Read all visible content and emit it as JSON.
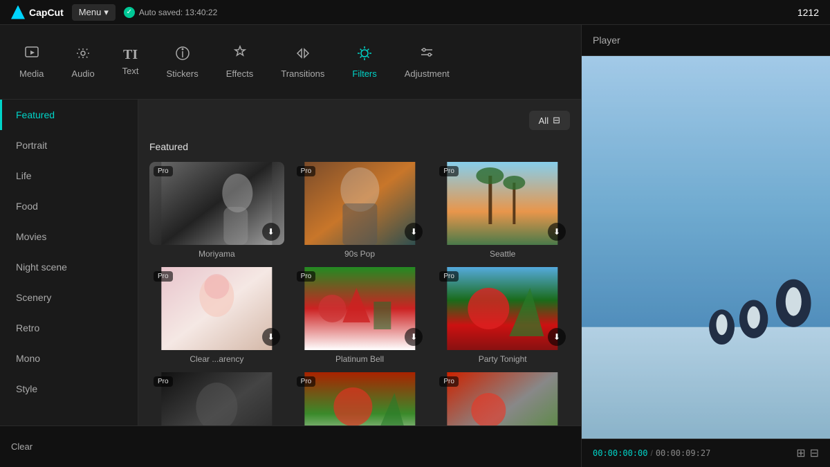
{
  "topbar": {
    "logo_text": "CapCut",
    "menu_label": "Menu",
    "autosaved_text": "Auto saved: 13:40:22",
    "project_number": "1212"
  },
  "nav": {
    "tabs": [
      {
        "id": "media",
        "label": "Media",
        "icon": "▶"
      },
      {
        "id": "audio",
        "label": "Audio",
        "icon": "♪"
      },
      {
        "id": "text",
        "label": "Text",
        "icon": "TI"
      },
      {
        "id": "stickers",
        "label": "Stickers",
        "icon": "⏱"
      },
      {
        "id": "effects",
        "label": "Effects",
        "icon": "✦"
      },
      {
        "id": "transitions",
        "label": "Transitions",
        "icon": "⋈"
      },
      {
        "id": "filters",
        "label": "Filters",
        "icon": "◎",
        "active": true
      },
      {
        "id": "adjustment",
        "label": "Adjustment",
        "icon": "⚙"
      }
    ]
  },
  "sidebar": {
    "items": [
      {
        "id": "featured",
        "label": "Featured",
        "active": true
      },
      {
        "id": "portrait",
        "label": "Portrait"
      },
      {
        "id": "life",
        "label": "Life"
      },
      {
        "id": "food",
        "label": "Food"
      },
      {
        "id": "movies",
        "label": "Movies"
      },
      {
        "id": "nightscene",
        "label": "Night scene"
      },
      {
        "id": "scenery",
        "label": "Scenery"
      },
      {
        "id": "retro",
        "label": "Retro"
      },
      {
        "id": "mono",
        "label": "Mono"
      },
      {
        "id": "style",
        "label": "Style"
      }
    ]
  },
  "filters": {
    "all_btn": "All",
    "section_title": "Featured",
    "items": [
      {
        "id": "moriyama",
        "name": "Moriyama",
        "badge": "Pro",
        "thumb_class": "thumb-moriyama"
      },
      {
        "id": "90spop",
        "name": "90s Pop",
        "badge": "Pro",
        "thumb_class": "thumb-90spop"
      },
      {
        "id": "seattle",
        "name": "Seattle",
        "badge": "Pro",
        "thumb_class": "thumb-seattle"
      },
      {
        "id": "clearancy",
        "name": "Clear ...arency",
        "badge": "Pro",
        "thumb_class": "thumb-clearancy"
      },
      {
        "id": "platinumbell",
        "name": "Platinum Bell",
        "badge": "Pro",
        "thumb_class": "thumb-platinum"
      },
      {
        "id": "partytonight",
        "name": "Party Tonight",
        "badge": "Pro",
        "thumb_class": "thumb-party"
      },
      {
        "id": "extra1",
        "name": "",
        "badge": "Pro",
        "thumb_class": "thumb-extra1"
      },
      {
        "id": "extra2",
        "name": "",
        "badge": "Pro",
        "thumb_class": "thumb-extra2"
      },
      {
        "id": "extra3",
        "name": "",
        "badge": "Pro",
        "thumb_class": "thumb-extra3"
      }
    ]
  },
  "player": {
    "title": "Player",
    "time_current": "00:00:00:00",
    "time_total": "00:00:09:27"
  },
  "bottom": {
    "clear_label": "Clear"
  }
}
